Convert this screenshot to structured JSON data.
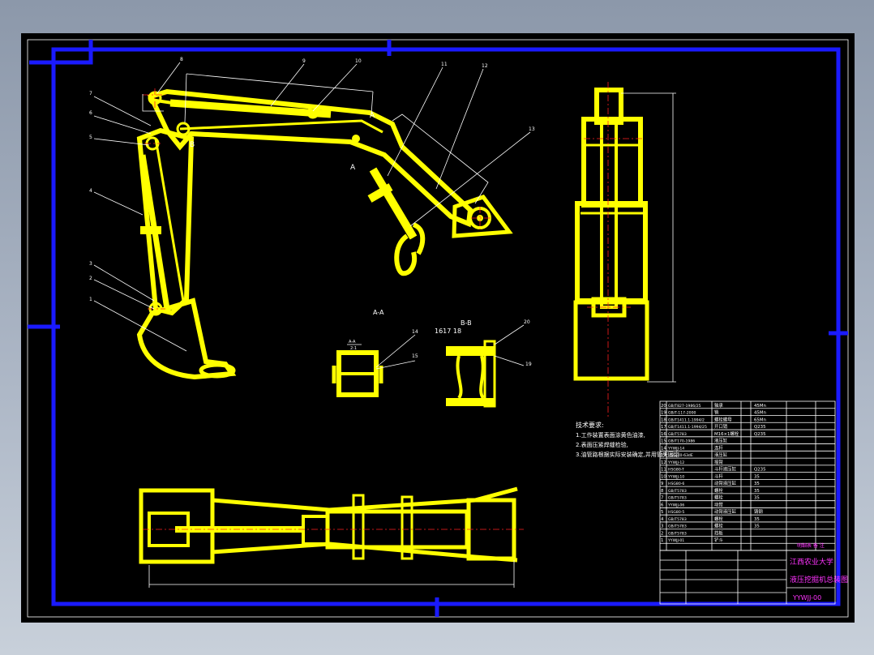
{
  "drawing": {
    "section_aa_label": "A-A",
    "section_bb_label": "B-B",
    "section_aa_small": "A-A",
    "section_aa_scale": "2:1",
    "bb_note": "1617 18",
    "cut_a1": "A",
    "cut_a2": "A",
    "cut_b": "B"
  },
  "tech_notes": {
    "title": "技术要求:",
    "lines": [
      "1.工作装置表面涂黄色油漆,",
      "2.表面压紧焊缝检验,",
      "3.油管路根据实际安装确定,并用管夹固定"
    ]
  },
  "title_block": {
    "university": "江西农业大学",
    "drawing_title": "液压挖掘机总装图",
    "drawing_number": "YYWJJ-00",
    "header_right": "明细表 备 注"
  },
  "bom_rows": [
    {
      "no": "20",
      "code": "GB/T827-1986/25",
      "name": "轴承",
      "mat": "45Mn"
    },
    {
      "no": "19",
      "code": "GB/T-117-2000",
      "name": "销",
      "mat": "45Mn"
    },
    {
      "no": "18",
      "code": "GB/T1411.1-1994/2",
      "name": "螺栓螺母",
      "mat": "65Mn"
    },
    {
      "no": "17",
      "code": "GB/T1411.1-1994/25",
      "name": "开口销",
      "mat": "Q235"
    },
    {
      "no": "16",
      "code": "GB/T5783",
      "name": "M16×1螺栓",
      "mat": "Q235"
    },
    {
      "no": "15",
      "code": "GB/T170-1986",
      "name": "液压缸",
      "mat": ""
    },
    {
      "no": "14",
      "code": "YYWJJ-14",
      "name": "连杆",
      "mat": ""
    },
    {
      "no": "13",
      "code": "HSG-40-63dE",
      "name": "液压缸",
      "mat": ""
    },
    {
      "no": "12",
      "code": "YYWJJ-12",
      "name": "摇臂",
      "mat": ""
    },
    {
      "no": "11",
      "code": "HSG80-T",
      "name": "斗杆液压缸",
      "mat": "Q235"
    },
    {
      "no": "10",
      "code": "YYWJJ-10",
      "name": "斗杆",
      "mat": "35"
    },
    {
      "no": "9",
      "code": "HSG80-6",
      "name": "动臂液压缸",
      "mat": "35"
    },
    {
      "no": "8",
      "code": "GB/T5783",
      "name": "螺栓",
      "mat": "35"
    },
    {
      "no": "7",
      "code": "GB/T5783",
      "name": "螺栓",
      "mat": "35"
    },
    {
      "no": "6",
      "code": "YYWJJ-06",
      "name": "动臂",
      "mat": ""
    },
    {
      "no": "5",
      "code": "HSG80-5",
      "name": "动臂液压缸",
      "mat": "铸钢"
    },
    {
      "no": "4",
      "code": "GB/T5783",
      "name": "螺栓",
      "mat": "35"
    },
    {
      "no": "3",
      "code": "GB/T5783",
      "name": "螺栓",
      "mat": "35"
    },
    {
      "no": "2",
      "code": "GB/T5783",
      "name": "挡板",
      "mat": ""
    },
    {
      "no": "1",
      "code": "YYWJJ-01",
      "name": "铲斗",
      "mat": ""
    }
  ],
  "balloons": [
    "8",
    "9",
    "10",
    "11",
    "12",
    "13",
    "7",
    "6",
    "5",
    "4",
    "3",
    "2",
    "1",
    "20",
    "19",
    "14",
    "15"
  ],
  "colors": {
    "frame": "#1a1aff",
    "part": "#ffff00",
    "center": "#ff2020",
    "text": "#ff33ff",
    "sheet": "#000000"
  }
}
